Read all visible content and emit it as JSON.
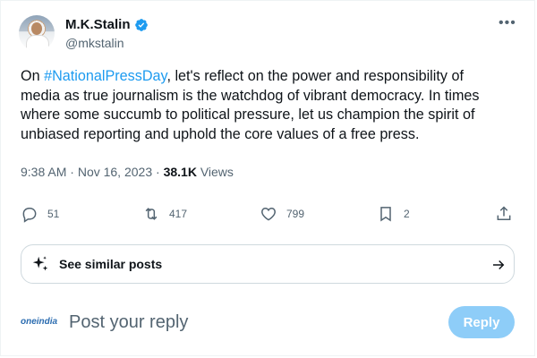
{
  "author": {
    "name": "M.K.Stalin",
    "handle": "@mkstalin"
  },
  "tweet": {
    "prefix": "On ",
    "hashtag": "#NationalPressDay",
    "line1_rest": ", let's reflect on the power and responsibility of",
    "line2": "media as true journalism is the watchdog of vibrant democracy. In times",
    "line3": "where some succumb to political pressure, let us champion the spirit of",
    "line4": "unbiased reporting and uphold the core values of a free press."
  },
  "meta": {
    "time": "9:38 AM",
    "separator": " · ",
    "date": "Nov 16, 2023",
    "views_count": "38.1K",
    "views_label": " Views"
  },
  "actions": {
    "replies": "51",
    "reposts": "417",
    "likes": "799",
    "bookmarks": "2"
  },
  "similar": {
    "label": "See similar posts"
  },
  "reply": {
    "logo_text": "oneindia",
    "placeholder": "Post your reply",
    "button_label": "Reply"
  },
  "colors": {
    "accent": "#1d9bf0",
    "muted": "#536471",
    "reply_button": "#8ecdf8"
  },
  "icons": [
    "verified-icon",
    "more-icon",
    "reply-icon",
    "repost-icon",
    "like-icon",
    "bookmark-icon",
    "share-icon",
    "sparkle-icon",
    "arrow-right-icon"
  ]
}
